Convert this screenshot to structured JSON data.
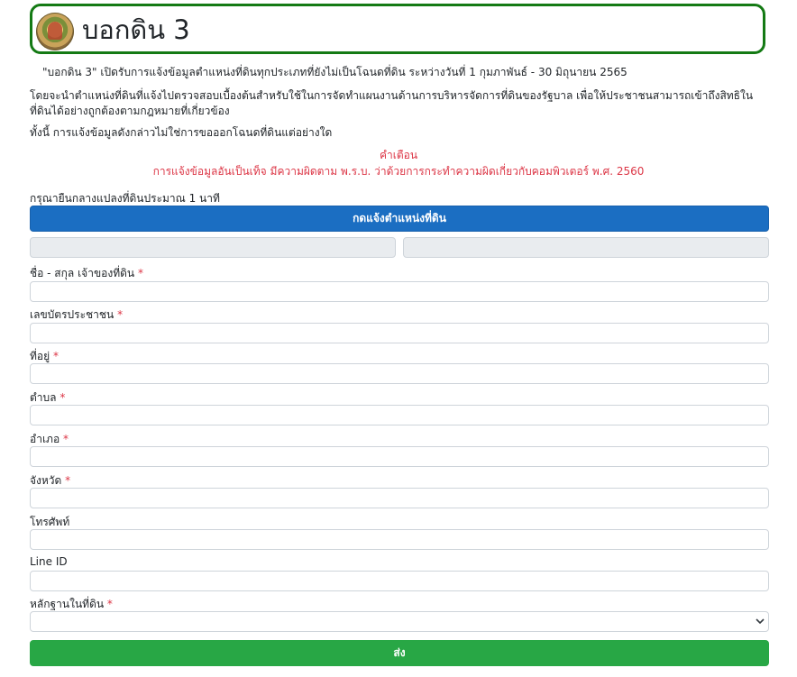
{
  "header": {
    "title": "บอกดิน 3",
    "logo_icon": "department-seal-icon"
  },
  "intro": {
    "line1": "\"บอกดิน 3\" เปิดรับการแจ้งข้อมูลตำแหน่งที่ดินทุกประเภทที่ยังไม่เป็นโฉนดที่ดิน ระหว่างวันที่ 1 กุมภาพันธ์ - 30 มิถุนายน 2565",
    "line2": "โดยจะนำตำแหน่งที่ดินที่แจ้งไปตรวจสอบเบื้องต้นสำหรับใช้ในการจัดทำแผนงานด้านการบริหารจัดการที่ดินของรัฐบาล เพื่อให้ประชาชนสามารถเข้าถึงสิทธิในที่ดินได้อย่างถูกต้องตามกฎหมายที่เกี่ยวข้อง",
    "line3": "ทั้งนี้ การแจ้งข้อมูลดังกล่าวไม่ใช่การขอออกโฉนดที่ดินแต่อย่างใด"
  },
  "warning": {
    "title": "คำเตือน",
    "text": "การแจ้งข้อมูลอันเป็นเท็จ มีความผิดตาม พ.ร.บ. ว่าด้วยการกระทำความผิดเกี่ยวกับคอมพิวเตอร์ พ.ศ. 2560"
  },
  "location": {
    "instruction": "กรุณายืนกลางแปลงที่ดินประมาณ 1 นาที",
    "button_label": "กดแจ้งตำแหน่งที่ดิน",
    "lat_value": "",
    "lng_value": ""
  },
  "form": {
    "required_mark": "*",
    "fields": [
      {
        "label": "ชื่อ - สกุล เจ้าของที่ดิน",
        "value": ""
      },
      {
        "label": "เลขบัตรประชาชน",
        "value": ""
      },
      {
        "label": "ที่อยู่",
        "value": ""
      },
      {
        "label": "ตำบล",
        "value": ""
      },
      {
        "label": "อำเภอ",
        "value": ""
      },
      {
        "label": "จังหวัด",
        "value": ""
      },
      {
        "label": "โทรศัพท์",
        "value": ""
      },
      {
        "label": "Line ID",
        "value": ""
      }
    ],
    "evidence": {
      "label": "หลักฐานในที่ดิน",
      "selected": ""
    },
    "submit_label": "ส่ง"
  },
  "colors": {
    "header_border": "#147a14",
    "primary_button": "#1b6ec2",
    "submit_button": "#28a745",
    "warning_text": "#dc3545"
  }
}
